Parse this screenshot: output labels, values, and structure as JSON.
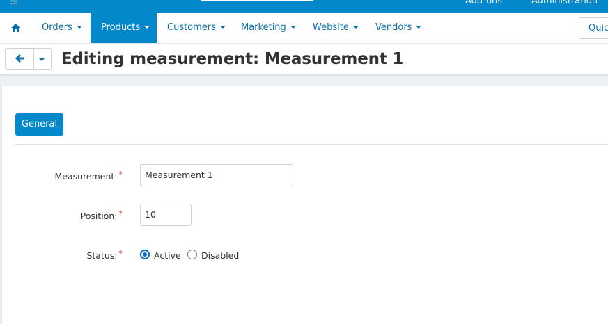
{
  "topbar": {
    "links": [
      "Add-ons",
      "Administration"
    ]
  },
  "nav": {
    "items": [
      {
        "label": "Orders"
      },
      {
        "label": "Products"
      },
      {
        "label": "Customers"
      },
      {
        "label": "Marketing"
      },
      {
        "label": "Website"
      },
      {
        "label": "Vendors"
      }
    ],
    "active": "Products",
    "quick_label": "Quick"
  },
  "header": {
    "title": "Editing measurement: Measurement 1"
  },
  "tabs": {
    "general_label": "General"
  },
  "form": {
    "measurement": {
      "label": "Measurement:",
      "value": "Measurement 1"
    },
    "position": {
      "label": "Position:",
      "value": "10"
    },
    "status": {
      "label": "Status:",
      "options": [
        "Active",
        "Disabled"
      ],
      "selected": "Active"
    },
    "required_marker": "*"
  },
  "colors": {
    "accent": "#0388cc",
    "link": "#0a6fa8",
    "required": "#e23c3c"
  },
  "icons": {
    "home": "home-icon",
    "back": "arrow-left-icon",
    "cart": "cart-icon"
  }
}
